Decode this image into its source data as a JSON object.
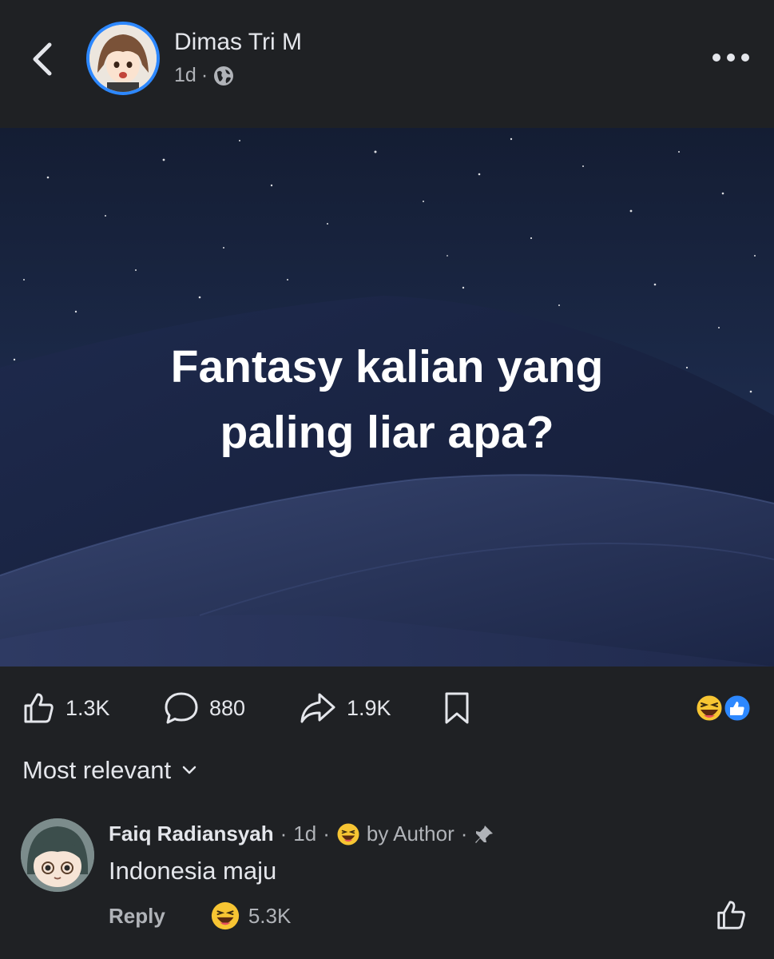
{
  "header": {
    "author_name": "Dimas Tri M",
    "time": "1d",
    "separator": "·",
    "privacy_icon": "globe-icon",
    "back_icon": "chevron-left-icon",
    "more_icon": "more-horizontal-icon"
  },
  "post": {
    "text_line1": "Fantasy kalian yang",
    "text_line2": "paling liar apa?"
  },
  "actions": {
    "likes": "1.3K",
    "comments": "880",
    "shares": "1.9K",
    "reaction_icons": [
      "haha-emoji-icon",
      "like-badge-icon"
    ]
  },
  "sort": {
    "label": "Most relevant"
  },
  "comment": {
    "author": "Faiq Radiansyah",
    "time": "1d",
    "author_reaction": "by Author",
    "text": "Indonesia maju",
    "reply_label": "Reply",
    "reaction_count": "5.3K"
  },
  "colors": {
    "background": "#1f2124",
    "accent_blue": "#2d88ff",
    "text_primary": "#e4e6eb",
    "text_secondary": "#b0b3b8",
    "emoji_yellow": "#f7c533"
  }
}
